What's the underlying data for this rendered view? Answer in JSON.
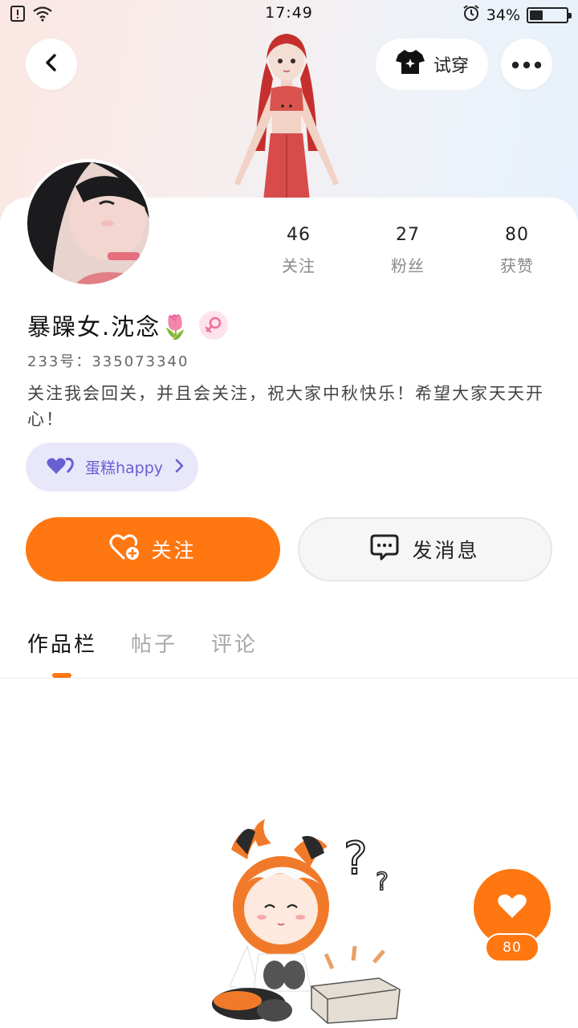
{
  "status_bar": {
    "time": "17:49",
    "battery_text": "34%",
    "battery_level": 0.34,
    "icons": [
      "sim-alert-icon",
      "wifi-icon",
      "alarm-icon",
      "battery-icon"
    ]
  },
  "header": {
    "tryon_label": "试穿",
    "icons": [
      "back-icon",
      "tshirt-icon",
      "more-icon"
    ]
  },
  "profile": {
    "username": "暴躁女.沈念🌷",
    "uid_label": "233号：335073340",
    "bio": "关注我会回关，并且会关注，祝大家中秋快乐！希望大家天天开心！",
    "gender": "female"
  },
  "stats": [
    {
      "value": "46",
      "label": "关注"
    },
    {
      "value": "27",
      "label": "粉丝"
    },
    {
      "value": "80",
      "label": "获赞"
    }
  ],
  "guild": {
    "name": "蛋糕happy"
  },
  "actions": {
    "follow_label": "关注",
    "message_label": "发消息"
  },
  "tabs": [
    {
      "label": "作品栏",
      "active": true
    },
    {
      "label": "帖子",
      "active": false
    },
    {
      "label": "评论",
      "active": false
    }
  ],
  "like_fab": {
    "count": "80"
  },
  "colors": {
    "accent": "#ff7711",
    "guild_bg": "#e9e8fb",
    "guild_text": "#6a5fd1",
    "gender_badge": "#fde3ec"
  }
}
